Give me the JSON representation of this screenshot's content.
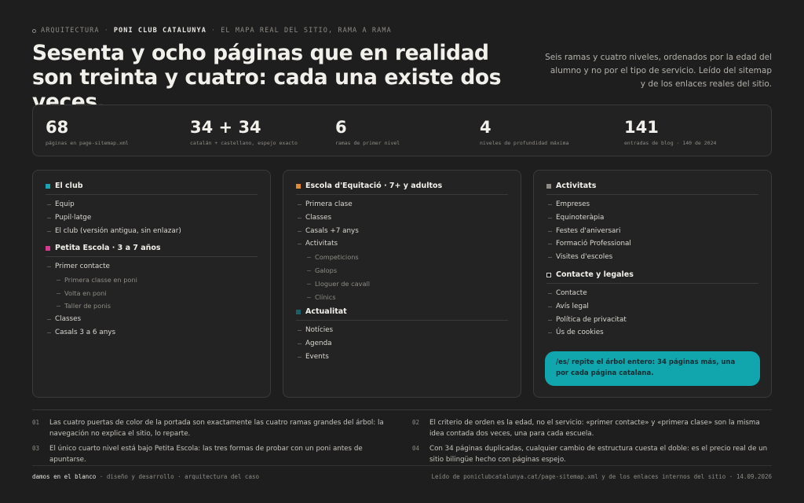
{
  "header": {
    "eyebrow_a": "ARQUITECTURA",
    "eyebrow_b": "PONI CLUB CATALUNYA",
    "eyebrow_c": "EL MAPA REAL DEL SITIO, RAMA A RAMA",
    "title": "Sesenta y ocho páginas que en realidad son treinta y cuatro: cada una existe dos veces.",
    "lede": "Seis ramas y cuatro niveles, ordenados por la edad del alumno y no por el tipo de servicio. Leído del sitemap y de los enlaces reales del sitio."
  },
  "stats": [
    {
      "num": "68",
      "cap": "páginas en page-sitemap.xml"
    },
    {
      "num": "34 + 34",
      "cap": "catalán + castellano, espejo exacto"
    },
    {
      "num": "6",
      "cap": "ramas de primer nivel"
    },
    {
      "num": "4",
      "cap": "niveles de profundidad máxima"
    },
    {
      "num": "141",
      "cap": "entradas de blog · 140 de 2024"
    }
  ],
  "colors": {
    "el_club": "#19a4b5",
    "petita_escola": "#d63b8f",
    "escola": "#e38b2c",
    "actualitat": "#1b5f6b",
    "activitats": "#8e8b84",
    "contacte": "#111111",
    "callout": "#11a6ae"
  },
  "card1": {
    "branch1": {
      "title": "El club",
      "items": [
        "Equip",
        "Pupil·latge",
        "El club (versión antigua, sin enlazar)"
      ]
    },
    "branch2": {
      "title": "Petita Escola · 3 a 7 años",
      "item1": "Primer contacte",
      "sub": [
        "Primera classe en poni",
        "Volta en poni",
        "Taller de ponis"
      ],
      "items": [
        "Classes",
        "Casals 3 a 6 anys"
      ]
    }
  },
  "card2": {
    "branch1": {
      "title": "Escola d'Equitació · 7+ y adultos",
      "items": [
        "Primera clase",
        "Classes",
        "Casals +7 anys",
        "Activitats"
      ],
      "sub": [
        "Competicions",
        "Galops",
        "Lloguer de cavall",
        "Clínics"
      ]
    },
    "branch2": {
      "title": "Actualitat",
      "items": [
        "Notícies",
        "Agenda",
        "Events"
      ]
    }
  },
  "card3": {
    "branch1": {
      "title": "Activitats",
      "items": [
        "Empreses",
        "Equinoteràpia",
        "Festes d'aniversari",
        "Formació Professional",
        "Visites d'escoles"
      ]
    },
    "branch2": {
      "title": "Contacte y legales",
      "items": [
        "Contacte",
        "Avís legal",
        "Política de privacitat",
        "Ús de cookies"
      ]
    },
    "callout": "/es/ repite el árbol entero: 34 páginas más, una por cada página catalana."
  },
  "notes": [
    {
      "idx": "01",
      "text": "Las cuatro puertas de color de la portada son exactamente las cuatro ramas grandes del árbol: la navegación no explica el sitio, lo reparte."
    },
    {
      "idx": "02",
      "text": "El criterio de orden es la edad, no el servicio: «primer contacte» y «primera clase» son la misma idea contada dos veces, una para cada escuela."
    },
    {
      "idx": "03",
      "text": "El único cuarto nivel está bajo Petita Escola: las tres formas de probar con un poni antes de apuntarse."
    },
    {
      "idx": "04",
      "text": "Con 34 páginas duplicadas, cualquier cambio de estructura cuesta el doble: es el precio real de un sitio bilingüe hecho con páginas espejo."
    }
  ],
  "footer": {
    "brand": "damos en el blanco",
    "left_rest": "· diseño y desarrollo · arquitectura del caso",
    "right": "Leído de poniclubcatalunya.cat/page-sitemap.xml y de los enlaces internos del sitio · 14.09.2026"
  }
}
